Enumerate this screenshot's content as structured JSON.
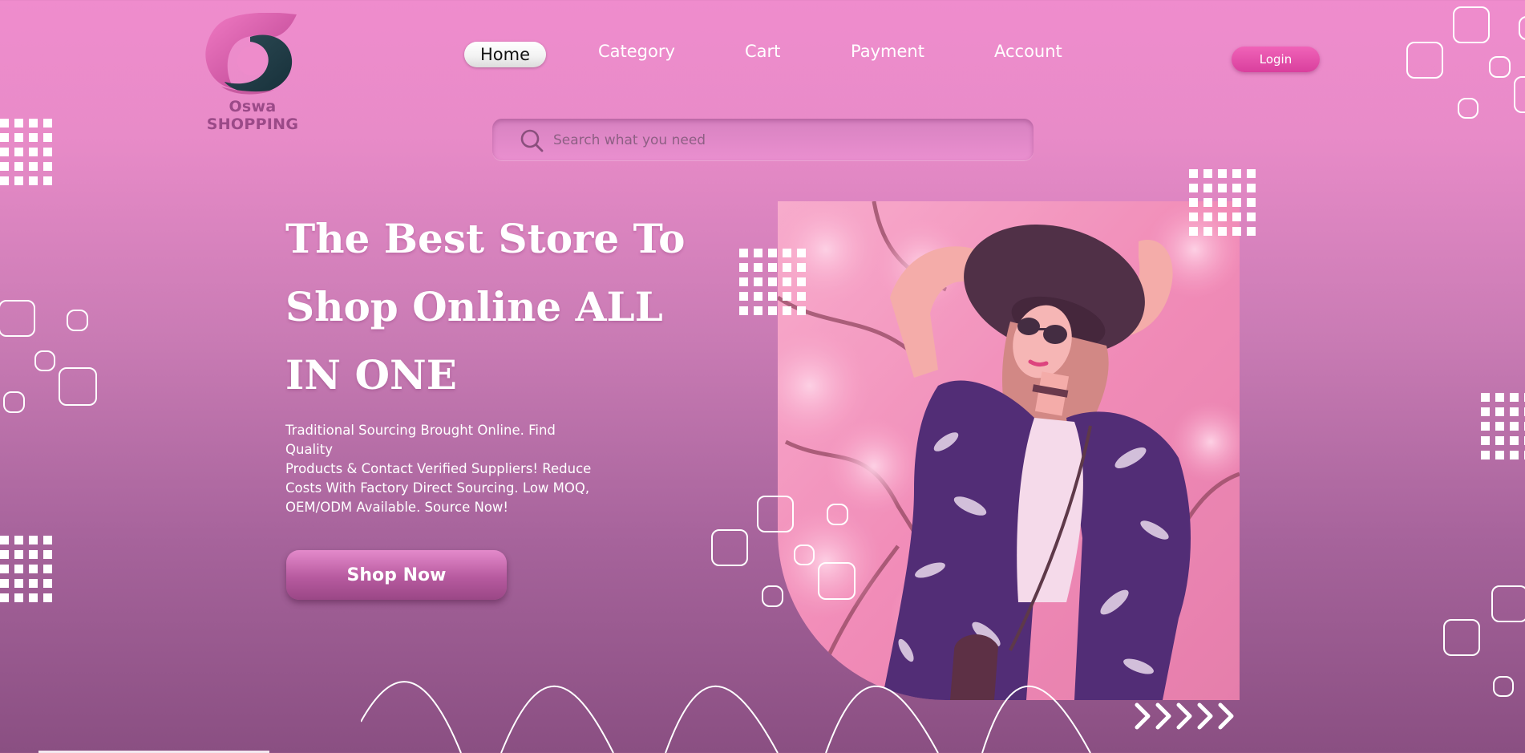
{
  "logo": {
    "text": "Oswa SHOPPING",
    "icon": "brand-swirl-icon"
  },
  "nav": {
    "items": [
      {
        "label": "Home",
        "active": true
      },
      {
        "label": "Category",
        "active": false
      },
      {
        "label": "Cart",
        "active": false
      },
      {
        "label": "Payment",
        "active": false
      },
      {
        "label": "Account",
        "active": false
      }
    ],
    "login_label": "Login"
  },
  "search": {
    "placeholder": "Search what you need",
    "value": "",
    "icon": "search-icon"
  },
  "hero": {
    "title_lines": [
      "The Best Store To",
      "Shop Online ALL",
      "IN ONE"
    ],
    "description_lines": [
      "Traditional Sourcing Brought Online. Find Quality",
      "Products & Contact Verified Suppliers! Reduce",
      "Costs With Factory Direct Sourcing. Low MOQ,",
      "OEM/ODM Available. Source Now!"
    ],
    "cta_label": "Shop Now",
    "image": "woman-in-hat-with-blossoms-photo"
  },
  "colors": {
    "background_top": "#ef8ccd",
    "background_bottom": "#8a4f82",
    "accent": "#e04aa5",
    "text": "#ffffff"
  }
}
